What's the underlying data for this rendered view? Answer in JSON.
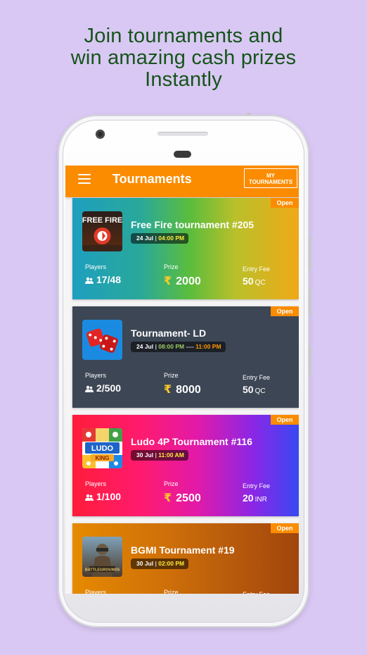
{
  "headline": {
    "line1": "Join tournaments and",
    "line2": "win amazing cash prizes",
    "line3": "Instantly"
  },
  "appbar": {
    "title": "Tournaments",
    "my_tournaments_line1": "MY",
    "my_tournaments_line2": "TOURNAMENTS",
    "color": "#fb8c00"
  },
  "labels": {
    "players": "Players",
    "prize": "Prize",
    "entry_fee": "Entry Fee",
    "currency_symbol": "₹"
  },
  "tournaments": [
    {
      "badge": "Open",
      "title": "Free Fire tournament #205",
      "date": "24 Jul",
      "time": "04:00 PM",
      "players": "17/48",
      "prize": "2000",
      "entry_fee": "50",
      "fee_unit": "QC",
      "icon": "free-fire-game-icon"
    },
    {
      "badge": "Open",
      "title": "Tournament- LD",
      "date": "24 Jul",
      "time": "08:00 PM",
      "time_sep": "----",
      "time_end": "11:00 PM",
      "players": "2/500",
      "prize": "8000",
      "entry_fee": "50",
      "fee_unit": "QC",
      "icon": "dice-game-icon"
    },
    {
      "badge": "Open",
      "title": "Ludo 4P Tournament #116",
      "date": "30 Jul",
      "time": "11:00 AM",
      "players": "1/100",
      "prize": "2500",
      "entry_fee": "20",
      "fee_unit": "INR",
      "icon": "ludo-king-game-icon"
    },
    {
      "badge": "Open",
      "title": "BGMI Tournament #19",
      "date": "30 Jul",
      "time": "02:00 PM",
      "icon": "bgmi-game-icon"
    }
  ]
}
